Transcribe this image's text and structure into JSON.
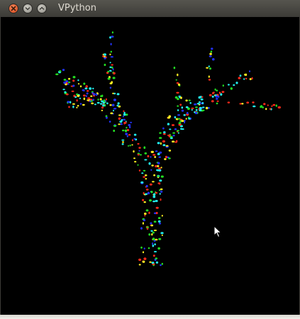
{
  "window": {
    "title": "VPython"
  },
  "titlebar_buttons": [
    {
      "icon": "close-icon"
    },
    {
      "icon": "minimize-icon"
    },
    {
      "icon": "maximize-icon"
    }
  ],
  "scene": {
    "particle_colors": [
      "#ff2a1a",
      "#ffee22",
      "#22dd22",
      "#2233ff",
      "#22eeee"
    ],
    "background": "#000000"
  }
}
